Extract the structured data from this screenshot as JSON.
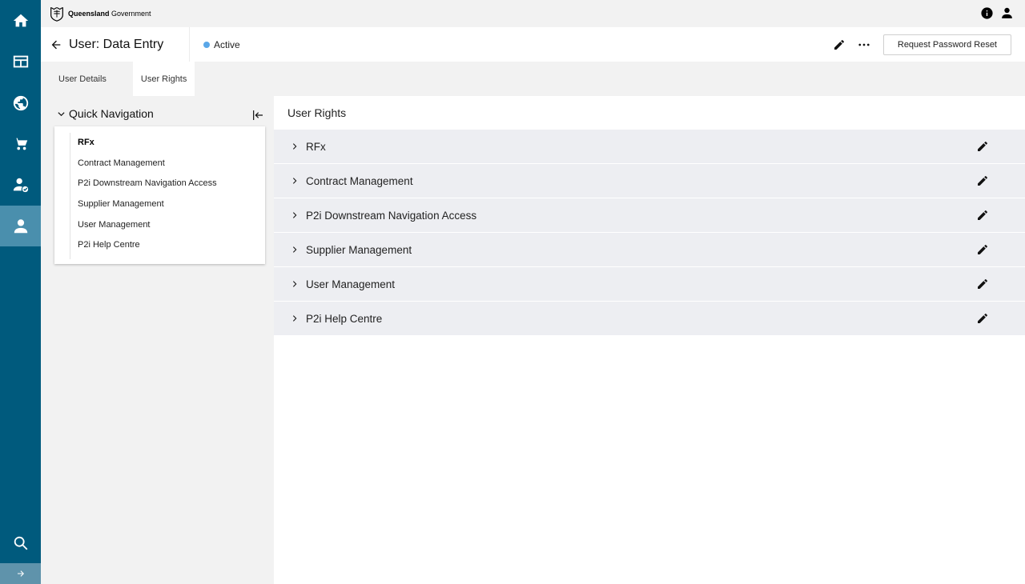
{
  "brand": {
    "name_bold": "Queensland",
    "name_rest": " Government"
  },
  "header": {
    "title": "User: Data Entry",
    "status": "Active",
    "status_color": "#5aa7e8",
    "reset_label": "Request Password Reset"
  },
  "tabs": [
    {
      "label": "User Details",
      "active": false
    },
    {
      "label": "User Rights",
      "active": true
    }
  ],
  "quick_nav": {
    "title": "Quick Navigation",
    "items": [
      "RFx",
      "Contract Management",
      "P2i Downstream Navigation Access",
      "Supplier Management",
      "User Management",
      "P2i Help Centre"
    ]
  },
  "main": {
    "title": "User Rights",
    "sections": [
      "RFx",
      "Contract Management",
      "P2i Downstream Navigation Access",
      "Supplier Management",
      "User Management",
      "P2i Help Centre"
    ]
  },
  "rail": {
    "icons": [
      "home-icon",
      "dashboard-icon",
      "globe-icon",
      "cart-icon",
      "user-check-icon",
      "user-icon",
      "search-icon",
      "expand-arrow-icon"
    ],
    "active": "user-icon",
    "color": "#005a7d"
  }
}
